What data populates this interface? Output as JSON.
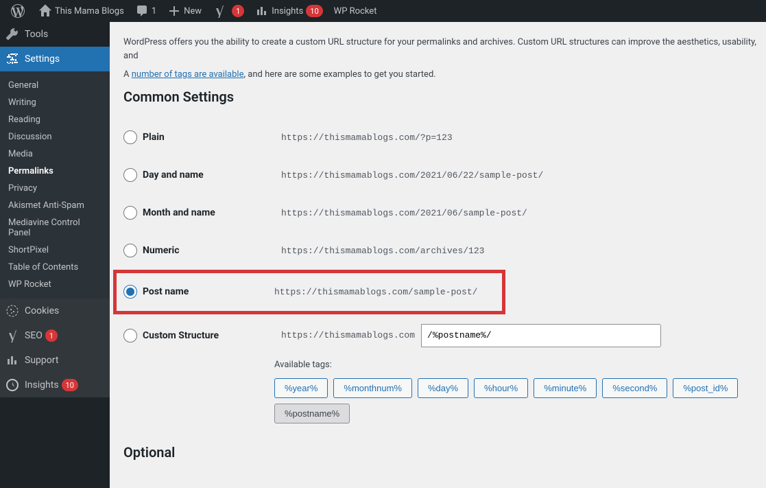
{
  "toolbar": {
    "site_name": "This Mama Blogs",
    "comments_count": "1",
    "new_label": "New",
    "yoast_count": "1",
    "insights_label": "Insights",
    "insights_count": "10",
    "wprocket_label": "WP Rocket"
  },
  "sidebar": {
    "tools": "Tools",
    "settings": "Settings",
    "cookies": "Cookies",
    "seo": "SEO",
    "seo_count": "1",
    "support": "Support",
    "insights": "Insights",
    "insights_count": "10"
  },
  "submenu": {
    "items": [
      "General",
      "Writing",
      "Reading",
      "Discussion",
      "Media",
      "Permalinks",
      "Privacy",
      "Akismet Anti-Spam",
      "Mediavine Control Panel",
      "ShortPixel",
      "Table of Contents",
      "WP Rocket"
    ],
    "active_index": 5
  },
  "intro": {
    "text_a": "WordPress offers you the ability to create a custom URL structure for your permalinks and archives. Custom URL structures can improve the aesthetics, usability, and",
    "text_b": "A ",
    "link": "number of tags are available",
    "text_c": ", and here are some examples to get you started."
  },
  "sections": {
    "common": "Common Settings",
    "optional": "Optional"
  },
  "options": [
    {
      "label": "Plain",
      "url": "https://thismamablogs.com/?p=123",
      "checked": false
    },
    {
      "label": "Day and name",
      "url": "https://thismamablogs.com/2021/06/22/sample-post/",
      "checked": false
    },
    {
      "label": "Month and name",
      "url": "https://thismamablogs.com/2021/06/sample-post/",
      "checked": false
    },
    {
      "label": "Numeric",
      "url": "https://thismamablogs.com/archives/123",
      "checked": false
    },
    {
      "label": "Post name",
      "url": "https://thismamablogs.com/sample-post/",
      "checked": true,
      "highlight": true
    }
  ],
  "custom": {
    "label": "Custom Structure",
    "base": "https://thismamablogs.com",
    "value": "/%postname%/"
  },
  "tags": {
    "label": "Available tags:",
    "items": [
      "%year%",
      "%monthnum%",
      "%day%",
      "%hour%",
      "%minute%",
      "%second%",
      "%post_id%",
      "%postname%"
    ],
    "active": "%postname%"
  }
}
